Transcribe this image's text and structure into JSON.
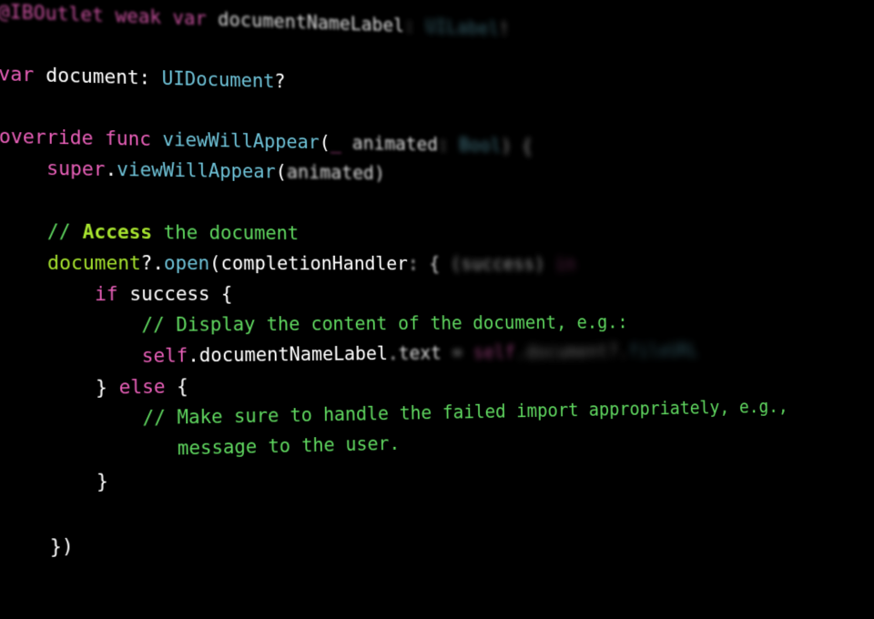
{
  "code": {
    "l1": {
      "attr": "@IBOutlet",
      "weak": "weak",
      "var": "var",
      "name": "documentNameLabel",
      "colon": ":",
      "type": "UILabel",
      "bang": "!"
    },
    "l2": {},
    "l3": {
      "var": "var",
      "name": "document",
      "colon": ":",
      "type": "UIDocument",
      "q": "?"
    },
    "l4": {},
    "l5": {
      "override": "override",
      "func": "func",
      "name": "viewWillAppear",
      "lp": "(",
      "underscore": "_",
      "param": "animated",
      "colon": ":",
      "ptype": "Bool",
      "rp": ")",
      "lb": "{"
    },
    "l6": {
      "super": "super",
      "dot": ".",
      "method": "viewWillAppear",
      "lp": "(",
      "arg": "animated",
      "rp": ")"
    },
    "l7": {},
    "l8": {
      "comment_prefix": "// ",
      "comment_highlight": "Access",
      "comment_rest": " the document"
    },
    "l9": {
      "obj": "document",
      "q": "?",
      "dot": ".",
      "method": "open",
      "lp": "(",
      "label": "completionHandler",
      "colon": ":",
      "lb": "{",
      "lp2": "(",
      "param": "success",
      "rp2": ")",
      "in": "in"
    },
    "l10": {
      "if": "if",
      "cond": "success",
      "lb": "{"
    },
    "l11": {
      "comment": "// Display the content of the document, e.g.:"
    },
    "l12": {
      "self": "self",
      "dot": ".",
      "prop": "documentNameLabel",
      "dot2": ".",
      "prop2": "text",
      "eq": "=",
      "self2": "self",
      "dot3": ".",
      "prop3": "document",
      "q": "?",
      "dot4": ".",
      "prop4": "fileURL"
    },
    "l13": {
      "rb": "}",
      "else": "else",
      "lb": "{"
    },
    "l14": {
      "comment": "// Make sure to handle the failed import appropriately, e.g.,"
    },
    "l15": {
      "comment": "   message to the user."
    },
    "l16": {
      "rb": "}"
    },
    "l17": {},
    "l18": {
      "rb": "})"
    }
  }
}
